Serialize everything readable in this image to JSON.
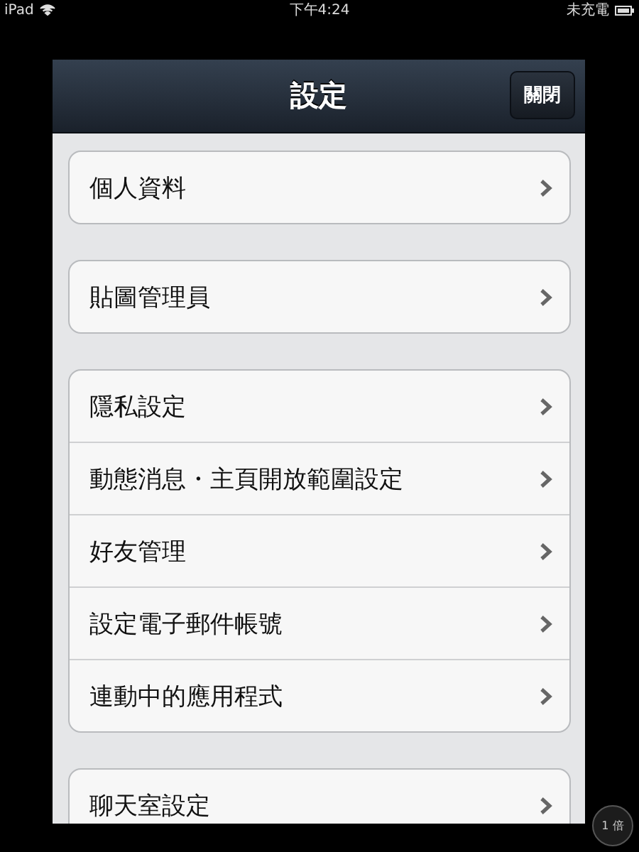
{
  "status_bar": {
    "device": "iPad",
    "time": "下午4:24",
    "battery_status": "未充電"
  },
  "header": {
    "title": "設定",
    "close_button": "關閉"
  },
  "groups": [
    {
      "items": [
        {
          "label": "個人資料"
        }
      ]
    },
    {
      "items": [
        {
          "label": "貼圖管理員"
        }
      ]
    },
    {
      "items": [
        {
          "label": "隱私設定"
        },
        {
          "label": "動態消息・主頁開放範圍設定"
        },
        {
          "label": "好友管理"
        },
        {
          "label": "設定電子郵件帳號"
        },
        {
          "label": "連動中的應用程式"
        }
      ]
    },
    {
      "items": [
        {
          "label": "聊天室設定"
        }
      ]
    }
  ],
  "zoom_badge": "1 倍"
}
